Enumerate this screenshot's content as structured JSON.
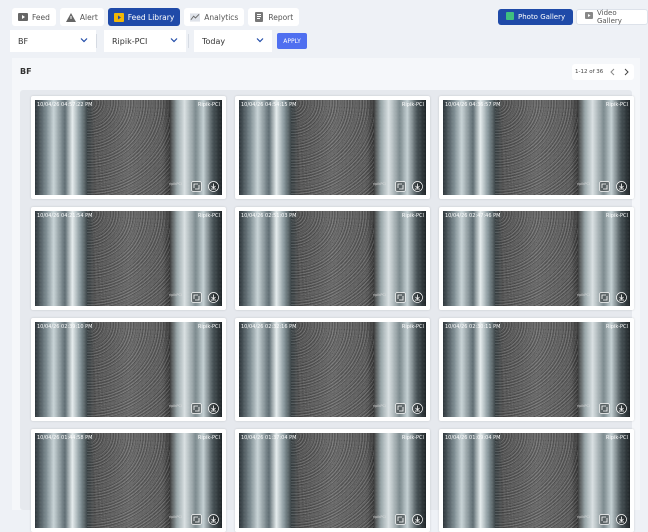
{
  "nav": [
    {
      "label": "Feed",
      "icon": "feed-icon",
      "active": false
    },
    {
      "label": "Alert",
      "icon": "alert-icon",
      "active": false
    },
    {
      "label": "Feed Library",
      "icon": "feed-library-icon",
      "active": true
    },
    {
      "label": "Analytics",
      "icon": "analytics-icon",
      "active": false
    },
    {
      "label": "Report",
      "icon": "report-icon",
      "active": false
    }
  ],
  "gallery": {
    "photo": "Photo Gallery",
    "video": "Video Gallery"
  },
  "filters": {
    "location": "BF",
    "camera": "Ripik-PCI",
    "date": "Today",
    "apply": "APPLY"
  },
  "panel": {
    "title": "BF",
    "pager": "1-12 of 36"
  },
  "cards": [
    {
      "timestamp": "10/04/26 04:57:22 PM",
      "camera": "Ripik-PCI",
      "watermark": "ripikPCI"
    },
    {
      "timestamp": "10/04/26 04:54:15 PM",
      "camera": "Ripik-PCI",
      "watermark": "ripikPCI"
    },
    {
      "timestamp": "10/04/26 04:36:57 PM",
      "camera": "Ripik-PCI",
      "watermark": "ripikPCI"
    },
    {
      "timestamp": "10/04/26 04:21:54 PM",
      "camera": "Ripik-PCI",
      "watermark": "ripikPCI"
    },
    {
      "timestamp": "10/04/26 02:51:03 PM",
      "camera": "Ripik-PCI",
      "watermark": "ripikPCI"
    },
    {
      "timestamp": "10/04/26 02:47:46 PM",
      "camera": "Ripik-PCI",
      "watermark": "ripikPCI"
    },
    {
      "timestamp": "10/04/26 02:39:10 PM",
      "camera": "Ripik-PCI",
      "watermark": "ripikPCI"
    },
    {
      "timestamp": "10/04/26 02:32:16 PM",
      "camera": "Ripik-PCI",
      "watermark": "ripikPCI"
    },
    {
      "timestamp": "10/04/26 02:30:11 PM",
      "camera": "Ripik-PCI",
      "watermark": "ripikPCI"
    },
    {
      "timestamp": "10/04/26 01:44:58 PM",
      "camera": "Ripik-PCI",
      "watermark": "ripikPCI"
    },
    {
      "timestamp": "10/04/26 01:37:04 PM",
      "camera": "Ripik-PCI",
      "watermark": "ripikPCI"
    },
    {
      "timestamp": "10/04/26 01:09:04 PM",
      "camera": "Ripik-PCI",
      "watermark": "ripikPCI"
    }
  ],
  "colors": {
    "accent": "#1f4aa8",
    "apply": "#4f6ff0"
  }
}
